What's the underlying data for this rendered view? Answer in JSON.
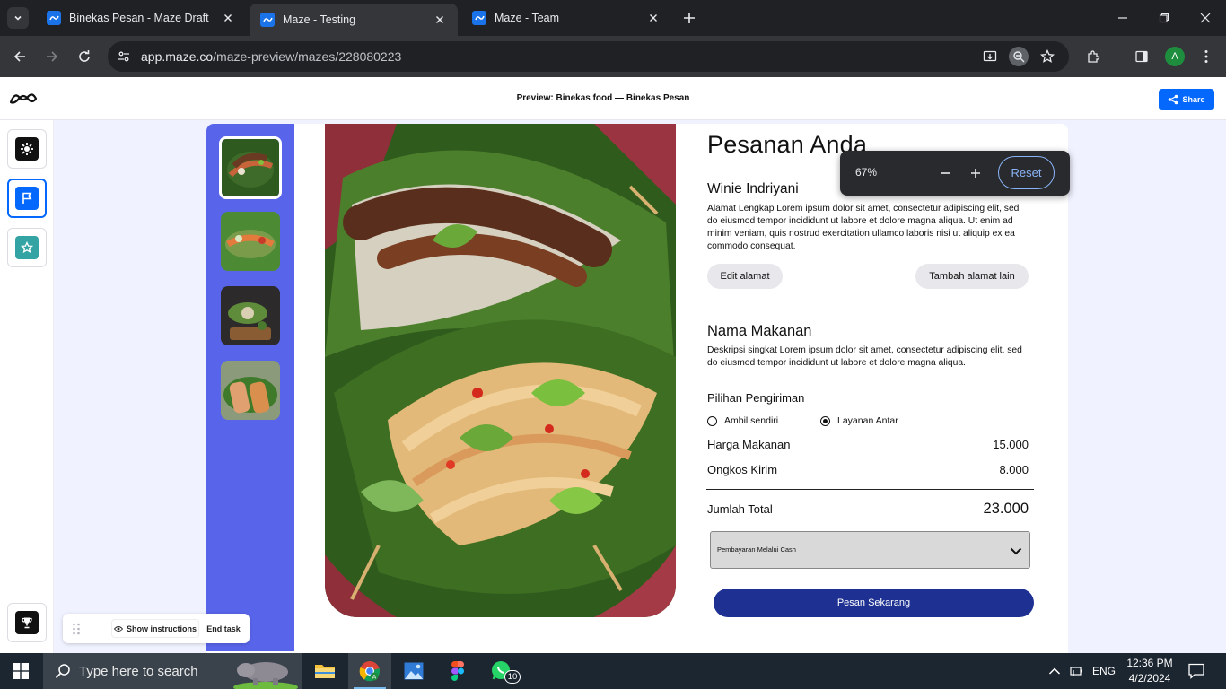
{
  "browser": {
    "tabs": [
      {
        "title": "Binekas Pesan - Maze Draft",
        "active": false
      },
      {
        "title": "Maze - Testing",
        "active": true
      },
      {
        "title": "Maze - Team",
        "active": false
      }
    ],
    "url_host": "app.maze.co",
    "url_path": "/maze-preview/mazes/228080223",
    "profile_initial": "A",
    "zoom_popup": {
      "value": "67%",
      "reset_label": "Reset"
    }
  },
  "maze": {
    "preview_title": "Preview: Binekas food — Binekas Pesan",
    "share_label": "Share",
    "show_instructions_label": "Show instructions",
    "end_task_label": "End task"
  },
  "order": {
    "heading": "Pesanan Anda",
    "customer_name": "Winie Indriyani",
    "address": "Alamat Lengkap Lorem ipsum dolor sit amet, consectetur adipiscing elit, sed do eiusmod tempor incididunt ut labore et dolore magna aliqua. Ut enim ad minim veniam, quis nostrud exercitation ullamco laboris nisi ut aliquip ex ea commodo consequat.",
    "edit_address_label": "Edit alamat",
    "add_address_label": "Tambah alamat lain",
    "food_name": "Nama Makanan",
    "food_desc": "Deskripsi singkat Lorem ipsum dolor sit amet, consectetur adipiscing elit, sed do eiusmod tempor incididunt ut labore et dolore magna aliqua.",
    "shipping_title": "Pilihan Pengiriman",
    "shipping_options": [
      {
        "label": "Ambil sendiri",
        "selected": false
      },
      {
        "label": "Layanan Antar",
        "selected": true
      }
    ],
    "food_price_label": "Harga Makanan",
    "food_price": "15.000",
    "shipping_cost_label": "Ongkos Kirim",
    "shipping_cost": "8.000",
    "total_label": "Jumlah Total",
    "total": "23.000",
    "payment_selected": "Pembayaran Melalui Cash",
    "order_button_label": "Pesan Sekarang"
  },
  "taskbar": {
    "search_placeholder": "Type here to search",
    "language": "ENG",
    "time": "12:36 PM",
    "date": "4/2/2024",
    "whatsapp_badge": "10"
  },
  "colors": {
    "accent_maze": "#0568fd",
    "thumb_column": "#5865ea",
    "order_button": "#1e3192"
  }
}
